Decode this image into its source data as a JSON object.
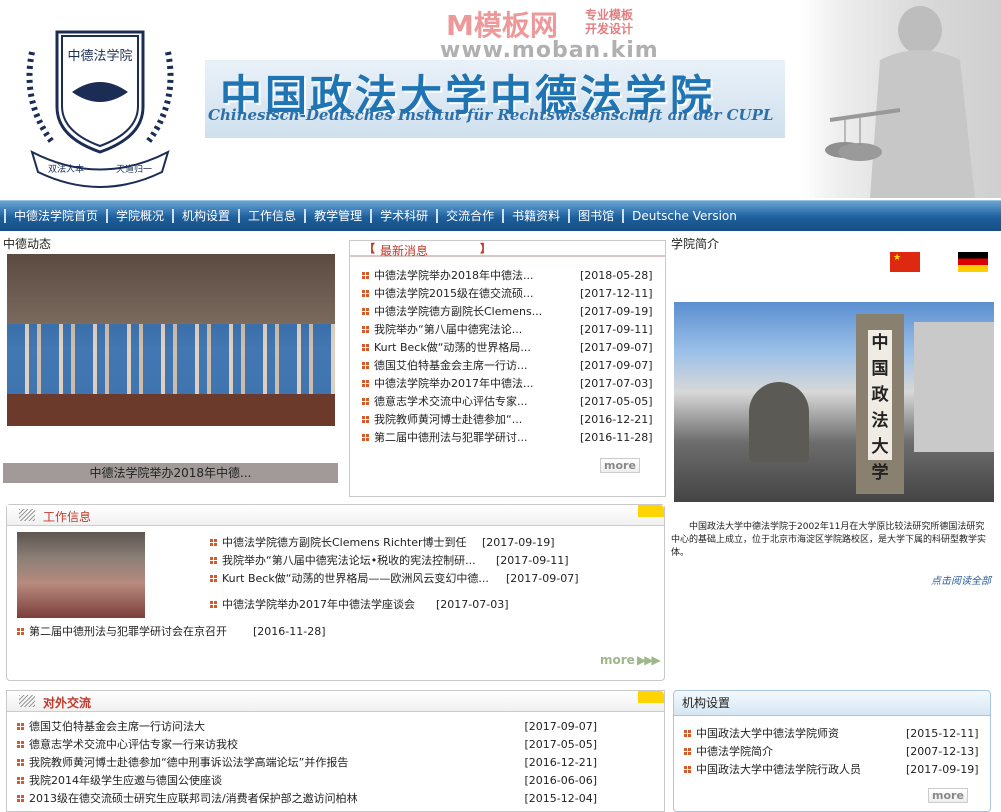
{
  "header": {
    "title_cn": "中国政法大学中德法学院",
    "title_de": "Chinesisch-Deutsches Institut für Rechtswissenschaft an der CUPL",
    "logo_text_top": "中德法学院",
    "logo_text_bottom_left": "双法人本",
    "logo_text_bottom_right": "天道归一",
    "watermark_brand": "M模板网",
    "watermark_tag1": "专业模板",
    "watermark_tag2": "开发设计",
    "watermark_url": "www.moban.kim"
  },
  "nav": [
    "中德法学院首页",
    "学院概况",
    "机构设置",
    "工作信息",
    "教学管理",
    "学术科研",
    "交流合作",
    "书籍资料",
    "图书馆",
    "Deutsche Version"
  ],
  "news_photo": {
    "label": "中德动态",
    "caption": "中德法学院举办2018年中德..."
  },
  "latest": {
    "title": "最新消息",
    "more": "more",
    "items": [
      {
        "text": "中德法学院举办2018年中德法...",
        "date": "[2018-05-28]"
      },
      {
        "text": "中德法学院2015级在德交流硕...",
        "date": "[2017-12-11]"
      },
      {
        "text": "中德法学院德方副院长Clemens...",
        "date": "[2017-09-19]"
      },
      {
        "text": "我院举办“第八届中德宪法论...",
        "date": "[2017-09-11]"
      },
      {
        "text": "Kurt Beck做“动荡的世界格局...",
        "date": "[2017-09-07]"
      },
      {
        "text": "德国艾伯特基金会主席一行访...",
        "date": "[2017-09-07]"
      },
      {
        "text": "中德法学院举办2017年中德法...",
        "date": "[2017-07-03]"
      },
      {
        "text": "德意志学术交流中心评估专家...",
        "date": "[2017-05-05]"
      },
      {
        "text": "我院教师黄河博士赴德参加“...",
        "date": "[2016-12-21]"
      },
      {
        "text": "第二届中德刑法与犯罪学研讨...",
        "date": "[2016-11-28]"
      }
    ]
  },
  "intro": {
    "label": "学院简介",
    "text": "中国政法大学中德法学院于2002年11月在大学原比较法研究所德国法研究中心的基础上成立，位于北京市海淀区学院路校区，是大学下属的科研型教学实体。",
    "read_more": "点击阅读全部",
    "gate_text": "中国政法大学"
  },
  "work": {
    "title": "工作信息",
    "more": "more",
    "items": [
      {
        "text": "中德法学院德方副院长Clemens Richter博士到任",
        "date": "[2017-09-19]"
      },
      {
        "text": "我院举办“第八届中德宪法论坛•税收的宪法控制研...",
        "date": "[2017-09-11]"
      },
      {
        "text": "Kurt Beck做“动荡的世界格局——欧洲风云变幻中德...",
        "date": "[2017-09-07]"
      },
      {
        "text": "中德法学院举办2017年中德法学座谈会",
        "date": "[2017-07-03]"
      },
      {
        "text": "第二届中德刑法与犯罪学研讨会在京召开",
        "date": "[2016-11-28]"
      }
    ]
  },
  "exchange": {
    "title": "对外交流",
    "items": [
      {
        "text": "德国艾伯特基金会主席一行访问法大",
        "date": "[2017-09-07]"
      },
      {
        "text": "德意志学术交流中心评估专家一行来访我校",
        "date": "[2017-05-05]"
      },
      {
        "text": "我院教师黄河博士赴德参加“德中刑事诉讼法学高端论坛”并作报告",
        "date": "[2016-12-21]"
      },
      {
        "text": "我院2014年级学生应邀与德国公使座谈",
        "date": "[2016-06-06]"
      },
      {
        "text": "2013级在德交流硕士研究生应联邦司法/消费者保护部之邀访问柏林",
        "date": "[2015-12-04]"
      }
    ]
  },
  "org": {
    "title": "机构设置",
    "more": "more",
    "items": [
      {
        "text": "中国政法大学中德法学院师资",
        "date": "[2015-12-11]"
      },
      {
        "text": "中德法学院简介",
        "date": "[2007-12-13]"
      },
      {
        "text": "中国政法大学中德法学院行政人员",
        "date": "[2017-09-19]"
      }
    ]
  }
}
